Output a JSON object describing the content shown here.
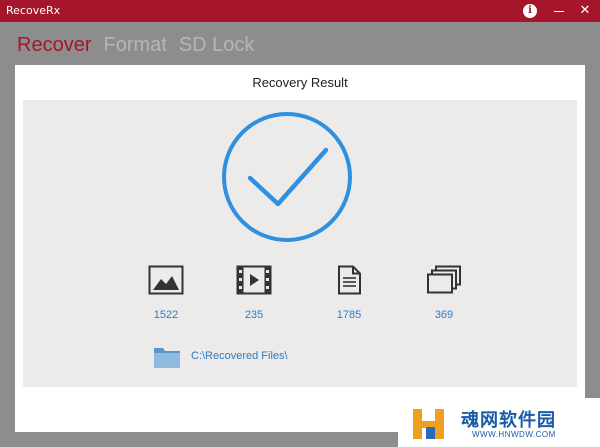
{
  "window": {
    "title": "RecoveRx"
  },
  "titlebar": {
    "info_glyph": "i",
    "minimize_label": "—",
    "close_label": "✕"
  },
  "nav": {
    "items": [
      {
        "label": "Recover",
        "active": true
      },
      {
        "label": "Format",
        "active": false
      },
      {
        "label": "SD Lock",
        "active": false
      }
    ]
  },
  "panel": {
    "title": "Recovery Result"
  },
  "result": {
    "status_icon": "checkmark-circle-icon",
    "accent_color": "#2f8fe0",
    "stats": [
      {
        "type": "photos",
        "icon": "image-icon",
        "count": "1522"
      },
      {
        "type": "videos",
        "icon": "video-icon",
        "count": "235"
      },
      {
        "type": "documents",
        "icon": "document-icon",
        "count": "1785"
      },
      {
        "type": "others",
        "icon": "stack-icon",
        "count": "369"
      }
    ],
    "output_path": "C:\\Recovered Files\\",
    "folder_icon": "folder-icon"
  },
  "colors": {
    "brand": "#a5162a",
    "link": "#2d7cc6",
    "background": "#8d8d8d"
  },
  "watermark": {
    "text": "魂网软件园",
    "url": "WWW.HNWDW.COM",
    "logo_letter": "H"
  }
}
